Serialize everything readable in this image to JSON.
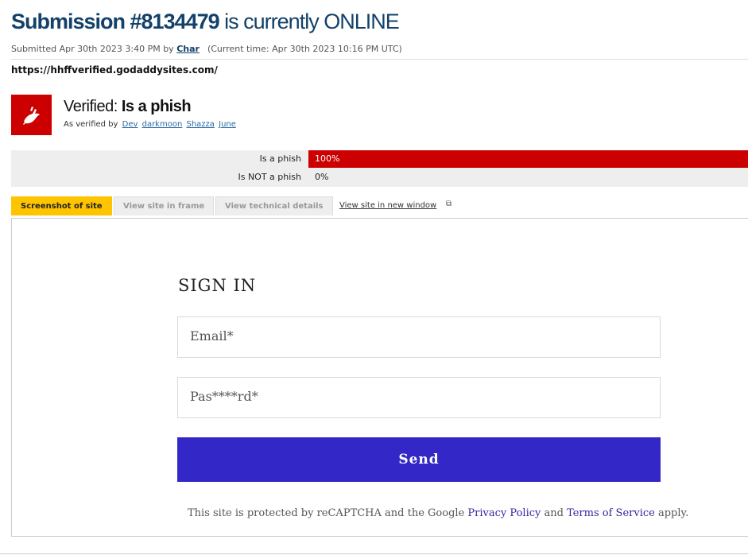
{
  "header": {
    "submission_label": "Submission #8134479",
    "status_text": " is currently ONLINE",
    "submitted_prefix": "Submitted Apr 30th 2023 3:40 PM by ",
    "submitter": "Char",
    "current_time": "(Current time: Apr 30th 2023 10:16 PM UTC)",
    "url": "https://hhffverified.godaddysites.com/"
  },
  "verdict": {
    "prefix": "Verified: ",
    "result": "Is a phish",
    "verified_by_label": "As verified by",
    "verifiers": [
      "Dev",
      "darkmoon",
      "Shazza",
      "June"
    ],
    "badge_color": "#cc0000"
  },
  "votes": [
    {
      "label": "Is a phish",
      "percent_text": "100%",
      "percent": 100
    },
    {
      "label": "Is NOT a phish",
      "percent_text": "0%",
      "percent": 0
    }
  ],
  "tabs": {
    "screenshot": "Screenshot of site",
    "frame": "View site in frame",
    "technical": "View technical details",
    "new_window": "View site in new window"
  },
  "site": {
    "heading": "SIGN IN",
    "email_placeholder": "Email*",
    "password_placeholder": "Pas****rd*",
    "send_label": "Send",
    "legal_prefix": "This site is protected by reCAPTCHA and the Google ",
    "privacy": "Privacy Policy",
    "and": " and ",
    "terms": "Terms of Service",
    "legal_suffix": " apply.",
    "button_color": "#3328c7"
  }
}
